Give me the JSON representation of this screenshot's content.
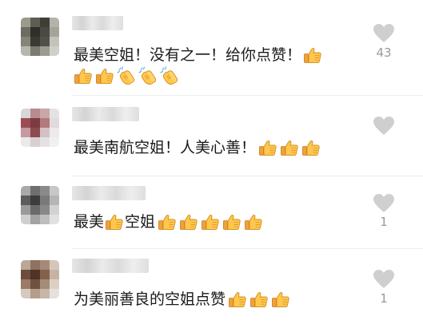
{
  "comments": [
    {
      "text": "最美空姐！没有之一！给你点赞！",
      "trailing_emojis": [
        "thumbs-up"
      ],
      "second_line_emojis": [
        "thumbs-up",
        "thumbs-up",
        "clapping-hands",
        "clapping-hands",
        "clapping-hands"
      ],
      "like_count": "43",
      "avatar_colors": [
        "#9a9a8e",
        "#5d5d52",
        "#3f3f38",
        "#b3b3aa",
        "#6e6c62",
        "#2f2f29",
        "#4a4a42",
        "#a6a49a",
        "#858478",
        "#3a3a33",
        "#51504a",
        "#c4c3bb",
        "#b8b7ae",
        "#7c7b70",
        "#9d9c92",
        "#d0cfc8"
      ]
    },
    {
      "text": "最美南航空姐！人美心善！",
      "trailing_emojis": [
        "thumbs-up",
        "thumbs-up",
        "thumbs-up"
      ],
      "like_count": "",
      "avatar_colors": [
        "#d9d6d8",
        "#b88b8f",
        "#c9a6a8",
        "#e4e2e4",
        "#9b4d55",
        "#7e3a41",
        "#b07a7f",
        "#e0dadb",
        "#c69a9e",
        "#8c4a51",
        "#d3c1c3",
        "#eceaeb",
        "#ebe9ea",
        "#d8cfd0",
        "#e6e2e3",
        "#f1f0f0"
      ]
    },
    {
      "text_before": "最美",
      "text_after": "空姐",
      "middle_emoji": "thumbs-up",
      "trailing_emojis": [
        "thumbs-up",
        "thumbs-up",
        "thumbs-up",
        "thumbs-up",
        "thumbs-up"
      ],
      "like_count": "1",
      "avatar_colors": [
        "#a9a9a9",
        "#6f6f6f",
        "#8a8a8a",
        "#c7c7c7",
        "#5c5c5c",
        "#3c3c3c",
        "#7a7a7a",
        "#b5b5b5",
        "#9a9a9a",
        "#6a6a6a",
        "#888888",
        "#d2d2d2",
        "#cfcfcf",
        "#a2a2a2",
        "#bdbdbd",
        "#e1e1e1"
      ]
    },
    {
      "text": "为美丽善良的空姐点赞",
      "trailing_emojis": [
        "thumbs-up",
        "thumbs-up",
        "thumbs-up"
      ],
      "like_count": "1",
      "avatar_colors": [
        "#b9a89a",
        "#8f7260",
        "#a48a78",
        "#d4c6bb",
        "#6d4c3b",
        "#4e3326",
        "#84614d",
        "#c7b3a4",
        "#9c7b66",
        "#71513f",
        "#a58b7a",
        "#dcd0c6",
        "#d6c9be",
        "#b59d8c",
        "#c8b6a8",
        "#e8e0da"
      ]
    }
  ],
  "colors": {
    "like_icon": "#cfcfcf",
    "like_count": "#999999",
    "text": "#1a1a1a"
  }
}
